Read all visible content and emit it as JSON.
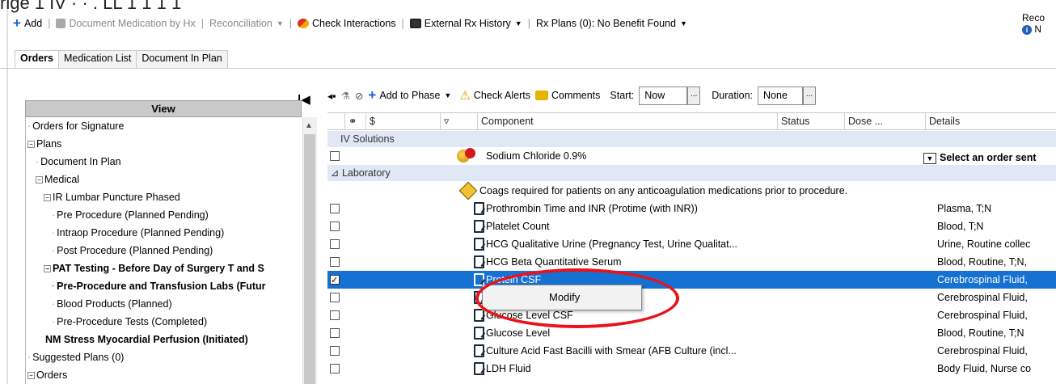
{
  "top_cut_text": "rige    1  IV  ·  ·  .  LL  1  1  1  1",
  "toolbar": {
    "add_label": "Add",
    "document_med_label": "Document Medication by Hx",
    "reconciliation_label": "Reconciliation",
    "check_interactions_label": "Check Interactions",
    "external_rx_label": "External Rx History",
    "rx_plans_label": "Rx Plans (0): No Benefit Found",
    "reco_label": "Reco",
    "reco_sub": "N"
  },
  "tabs": [
    "Orders",
    "Medication List",
    "Document In Plan"
  ],
  "left_panel": {
    "view_header": "View",
    "tree": [
      {
        "label": "Orders for Signature",
        "indent": 0,
        "bold": false,
        "glyph": "line"
      },
      {
        "label": "Plans",
        "indent": 0,
        "bold": false,
        "glyph": "minus"
      },
      {
        "label": "Document In Plan",
        "indent": 1,
        "bold": false,
        "glyph": "line"
      },
      {
        "label": "Medical",
        "indent": 1,
        "bold": false,
        "glyph": "minus"
      },
      {
        "label": "IR Lumbar Puncture Phased",
        "indent": 2,
        "bold": false,
        "glyph": "minus"
      },
      {
        "label": "Pre Procedure (Planned Pending)",
        "indent": 3,
        "bold": false,
        "glyph": "line"
      },
      {
        "label": "Intraop Procedure (Planned Pending)",
        "indent": 3,
        "bold": false,
        "glyph": "line"
      },
      {
        "label": "Post Procedure (Planned Pending)",
        "indent": 3,
        "bold": false,
        "glyph": "line"
      },
      {
        "label": "PAT Testing - Before Day of Surgery T and S",
        "indent": 2,
        "bold": true,
        "glyph": "minus"
      },
      {
        "label": "Pre-Procedure and Transfusion Labs (Futur",
        "indent": 3,
        "bold": true,
        "glyph": "line"
      },
      {
        "label": "Blood Products (Planned)",
        "indent": 3,
        "bold": false,
        "glyph": "line"
      },
      {
        "label": "Pre-Procedure Tests (Completed)",
        "indent": 3,
        "bold": false,
        "glyph": "line"
      },
      {
        "label": "NM Stress Myocardial Perfusion (Initiated)",
        "indent": 2,
        "bold": true,
        "glyph": "none"
      },
      {
        "label": "Suggested Plans (0)",
        "indent": 0,
        "bold": false,
        "glyph": "line"
      },
      {
        "label": "Orders",
        "indent": 0,
        "bold": false,
        "glyph": "minus"
      }
    ]
  },
  "grid_toolbar": {
    "add_to_phase": "Add to Phase",
    "check_alerts": "Check Alerts",
    "comments": "Comments",
    "start_label": "Start:",
    "start_value": "Now",
    "duration_label": "Duration:",
    "duration_value": "None",
    "ellipsis": "..."
  },
  "grid": {
    "headers": {
      "rx": "$",
      "component": "Component",
      "status": "Status",
      "dose": "Dose ...",
      "details": "Details"
    },
    "section_iv": "IV Solutions",
    "section_lab": "⊿ Laboratory",
    "iv_component": "Sodium Chloride 0.9%",
    "iv_select": "Select an order sent",
    "note_text": "Coags required for patients on any anticoagulation medications prior to procedure.",
    "rows": [
      {
        "component": "Prothrombin Time and INR (Protime (with INR))",
        "details": "Plasma, T;N",
        "checked": false,
        "selected": false
      },
      {
        "component": "Platelet Count",
        "details": "Blood, T;N",
        "checked": false,
        "selected": false
      },
      {
        "component": "HCG Qualitative Urine (Pregnancy Test, Urine Qualitat...",
        "details": "Urine, Routine collec",
        "checked": false,
        "selected": false
      },
      {
        "component": "HCG Beta Quantitative Serum",
        "details": "Blood, Routine, T;N,",
        "checked": false,
        "selected": false
      },
      {
        "component": "Protein CSF",
        "details": "Cerebrospinal Fluid,",
        "checked": true,
        "selected": true
      },
      {
        "component": "Cell C",
        "details": "Cerebrospinal Fluid,",
        "checked": false,
        "selected": false
      },
      {
        "component": "Glucose Level CSF",
        "details": "Cerebrospinal Fluid,",
        "checked": false,
        "selected": false
      },
      {
        "component": "Glucose Level",
        "details": "Blood, Routine, T;N",
        "checked": false,
        "selected": false
      },
      {
        "component": "Culture Acid Fast Bacilli with Smear (AFB Culture (incl...",
        "details": "Cerebrospinal Fluid,",
        "checked": false,
        "selected": false
      },
      {
        "component": "LDH Fluid",
        "details": "Body Fluid, Nurse co",
        "checked": false,
        "selected": false
      }
    ]
  },
  "context_menu": {
    "item": "Modify"
  },
  "colors": {
    "selection": "#1571d2",
    "section_bg": "#dfe8f4",
    "annotation": "#e8141c",
    "accent": "#1a63c8"
  }
}
